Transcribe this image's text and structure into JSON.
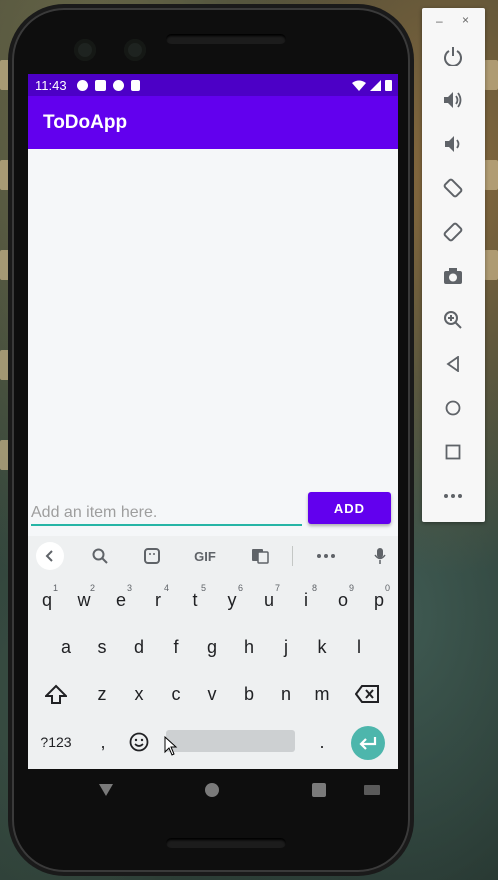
{
  "status_bar": {
    "time": "11:43"
  },
  "app": {
    "title": "ToDoApp"
  },
  "form": {
    "placeholder": "Add an item here.",
    "add_label": "ADD"
  },
  "keyboard": {
    "toolbar": [
      "back-chevron-icon",
      "search-icon",
      "sticker-icon",
      "GIF",
      "translate-icon",
      "more-icon",
      "mic-icon"
    ],
    "gif_label": "GIF",
    "row1": [
      {
        "k": "q",
        "n": "1"
      },
      {
        "k": "w",
        "n": "2"
      },
      {
        "k": "e",
        "n": "3"
      },
      {
        "k": "r",
        "n": "4"
      },
      {
        "k": "t",
        "n": "5"
      },
      {
        "k": "y",
        "n": "6"
      },
      {
        "k": "u",
        "n": "7"
      },
      {
        "k": "i",
        "n": "8"
      },
      {
        "k": "o",
        "n": "9"
      },
      {
        "k": "p",
        "n": "0"
      }
    ],
    "row2": [
      "a",
      "s",
      "d",
      "f",
      "g",
      "h",
      "j",
      "k",
      "l"
    ],
    "row3": [
      "z",
      "x",
      "c",
      "v",
      "b",
      "n",
      "m"
    ],
    "symbols_label": "?123",
    "comma": ",",
    "period": "."
  },
  "emulator_toolbar": {
    "icons": [
      "power-icon",
      "volume-up-icon",
      "volume-down-icon",
      "rotate-left-icon",
      "rotate-right-icon",
      "camera-icon",
      "zoom-icon",
      "back-icon",
      "home-icon",
      "overview-icon",
      "more-icon"
    ]
  },
  "colors": {
    "primary": "#6200ee",
    "primary_dark": "#4c00c6",
    "accent": "#26b5a6"
  }
}
